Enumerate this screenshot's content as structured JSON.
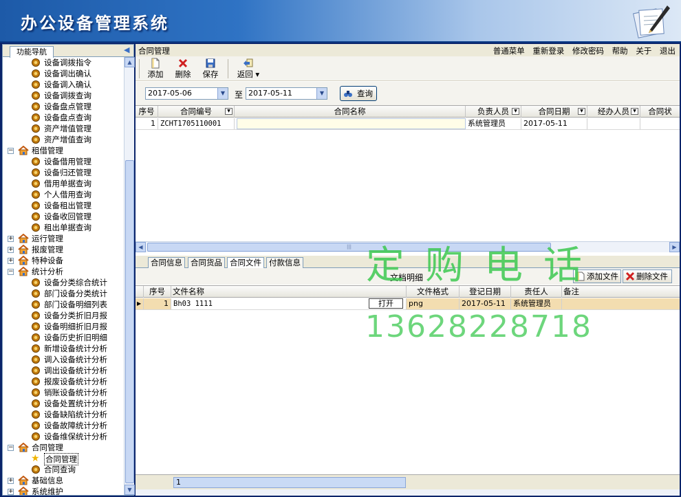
{
  "app": {
    "title": "办公设备管理系统"
  },
  "left_panel": {
    "tab": "功能导航",
    "tree": [
      {
        "kind": "child",
        "label": "设备调拨指令"
      },
      {
        "kind": "child",
        "label": "设备调出确认"
      },
      {
        "kind": "child",
        "label": "设备调入确认"
      },
      {
        "kind": "child",
        "label": "设备调拨查询"
      },
      {
        "kind": "child",
        "label": "设备盘点管理"
      },
      {
        "kind": "child",
        "label": "设备盘点查询"
      },
      {
        "kind": "child",
        "label": "资产增值管理"
      },
      {
        "kind": "child",
        "label": "资产增值查询"
      },
      {
        "kind": "group",
        "label": "租借管理",
        "expanded": true
      },
      {
        "kind": "child",
        "label": "设备借用管理"
      },
      {
        "kind": "child",
        "label": "设备归还管理"
      },
      {
        "kind": "child",
        "label": "借用单据查询"
      },
      {
        "kind": "child",
        "label": "个人借用查询"
      },
      {
        "kind": "child",
        "label": "设备租出管理"
      },
      {
        "kind": "child",
        "label": "设备收回管理"
      },
      {
        "kind": "child",
        "label": "租出单据查询"
      },
      {
        "kind": "group",
        "label": "运行管理",
        "expanded": false
      },
      {
        "kind": "group",
        "label": "报废管理",
        "expanded": false
      },
      {
        "kind": "group",
        "label": "特种设备",
        "expanded": false
      },
      {
        "kind": "group",
        "label": "统计分析",
        "expanded": true
      },
      {
        "kind": "child",
        "label": "设备分类综合统计"
      },
      {
        "kind": "child",
        "label": "部门设备分类统计"
      },
      {
        "kind": "child",
        "label": "部门设备明细列表"
      },
      {
        "kind": "child",
        "label": "设备分类折旧月报"
      },
      {
        "kind": "child",
        "label": "设备明细折旧月报"
      },
      {
        "kind": "child",
        "label": "设备历史折旧明细"
      },
      {
        "kind": "child",
        "label": "新增设备统计分析"
      },
      {
        "kind": "child",
        "label": "调入设备统计分析"
      },
      {
        "kind": "child",
        "label": "调出设备统计分析"
      },
      {
        "kind": "child",
        "label": "报废设备统计分析"
      },
      {
        "kind": "child",
        "label": "销账设备统计分析"
      },
      {
        "kind": "child",
        "label": "设备处置统计分析"
      },
      {
        "kind": "child",
        "label": "设备缺陷统计分析"
      },
      {
        "kind": "child",
        "label": "设备故障统计分析"
      },
      {
        "kind": "child",
        "label": "设备维保统计分析"
      },
      {
        "kind": "group",
        "label": "合同管理",
        "expanded": true
      },
      {
        "kind": "child",
        "label": "合同管理",
        "selected": true
      },
      {
        "kind": "child",
        "label": "合同查询"
      },
      {
        "kind": "group",
        "label": "基础信息",
        "expanded": false
      },
      {
        "kind": "group",
        "label": "系统维护",
        "expanded": false
      }
    ]
  },
  "header": {
    "page_title": "合同管理",
    "menu": [
      "普通菜单",
      "重新登录",
      "修改密码",
      "帮助",
      "关于",
      "退出"
    ]
  },
  "toolbar": {
    "add": "添加",
    "delete": "删除",
    "save": "保存",
    "back": "返回"
  },
  "filter": {
    "date_from": "2017-05-06",
    "to_label": "至",
    "date_to": "2017-05-11",
    "query": "查询"
  },
  "contract_grid": {
    "columns": [
      "序号",
      "合同编号",
      "合同名称",
      "负责人员",
      "合同日期",
      "经办人员",
      "合同状"
    ],
    "rows": [
      {
        "seq": "1",
        "code": "ZCHT1705110001",
        "name": "",
        "owner": "系统管理员",
        "date": "2017-05-11",
        "handler": "",
        "status": ""
      }
    ]
  },
  "detail_tabs": [
    "合同信息",
    "合同货品",
    "合同文件",
    "付款信息"
  ],
  "doc_section": {
    "title": "文档明细",
    "add_file": "添加文件",
    "delete_file": "删除文件"
  },
  "doc_grid": {
    "columns": [
      "序号",
      "文件名称",
      "文件格式",
      "登记日期",
      "责任人",
      "备注"
    ],
    "rows": [
      {
        "seq": "1",
        "file_name": "Bh03 1111",
        "open": "打开",
        "format": "png",
        "date": "2017-05-11",
        "owner": "系统管理员",
        "note": ""
      }
    ]
  },
  "footer": {
    "count": "1"
  },
  "watermark": {
    "line1": "定购电话",
    "line2": "13628228718"
  }
}
